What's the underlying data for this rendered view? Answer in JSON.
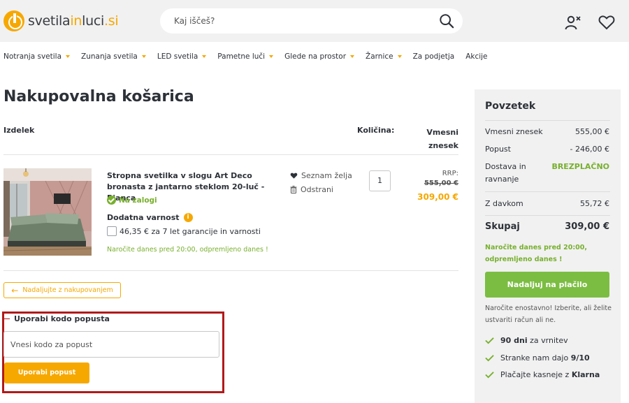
{
  "header": {
    "logo_main": "svetila",
    "logo_accent": "in",
    "logo_rest": "luci",
    "logo_tld": ".si",
    "search_placeholder": "Kaj iščeš?"
  },
  "nav": [
    {
      "label": "Notranja svetila",
      "dropdown": true
    },
    {
      "label": "Zunanja svetila",
      "dropdown": true
    },
    {
      "label": "LED svetila",
      "dropdown": true
    },
    {
      "label": "Pametne luči",
      "dropdown": true
    },
    {
      "label": "Glede na prostor",
      "dropdown": true
    },
    {
      "label": "Žarnice",
      "dropdown": true
    },
    {
      "label": "Za podjetja",
      "dropdown": false
    },
    {
      "label": "Akcije",
      "dropdown": false
    }
  ],
  "cart": {
    "title": "Nakupovalna košarica",
    "col_product": "Izdelek",
    "col_qty": "Količina:",
    "col_subtotal_1": "Vmesni",
    "col_subtotal_2": "znesek",
    "item": {
      "name": "Stropna svetilka v slogu Art Deco bronasta z jantarno steklom 20-luč - Bianca",
      "stock": "Na zalogi",
      "extra_title": "Dodatna varnost",
      "warranty": "46,35 € za 7 let garancije in varnosti",
      "order_note": "Naročite danes pred 20:00, odpremljeno danes !",
      "wishlist": "Seznam želja",
      "remove": "Odstrani",
      "qty": "1",
      "rrp_label": "RRP:",
      "old_price": "555,00 €",
      "price": "309,00 €"
    },
    "continue": "Nadaljujte z nakupovanjem",
    "coupon": {
      "title": "Uporabi kodo popusta",
      "placeholder": "Vnesi kodo za popust",
      "button": "Uporabi popust"
    }
  },
  "summary": {
    "title": "Povzetek",
    "rows": [
      {
        "label": "Vmesni znesek",
        "value": "555,00 €"
      },
      {
        "label": "Popust",
        "value": "- 246,00 €"
      },
      {
        "label_1": "Dostava in",
        "label_2": "ravnanje",
        "value": "BREZPLAČNO"
      },
      {
        "label": "Z davkom",
        "value": "55,72 €"
      }
    ],
    "total_label": "Skupaj",
    "total_value": "309,00 €",
    "note": "Naročite danes pred 20:00, odpremljeno danes !",
    "pay_button": "Nadaljuj na plačilo",
    "hint": "Naročite enostavno! Izberite, ali želite ustvariti račun ali ne.",
    "perks": [
      {
        "bold": "90 dni",
        "text": " za vrnitev"
      },
      {
        "text": "Stranke nam dajo ",
        "bold": "9/10"
      },
      {
        "text": "Plačajte kasneje z ",
        "bold": "Klarna"
      }
    ]
  },
  "colors": {
    "accent": "#f6a800",
    "green": "#78b02e",
    "pay": "#7bbd42",
    "highlight": "#b11a1a"
  }
}
